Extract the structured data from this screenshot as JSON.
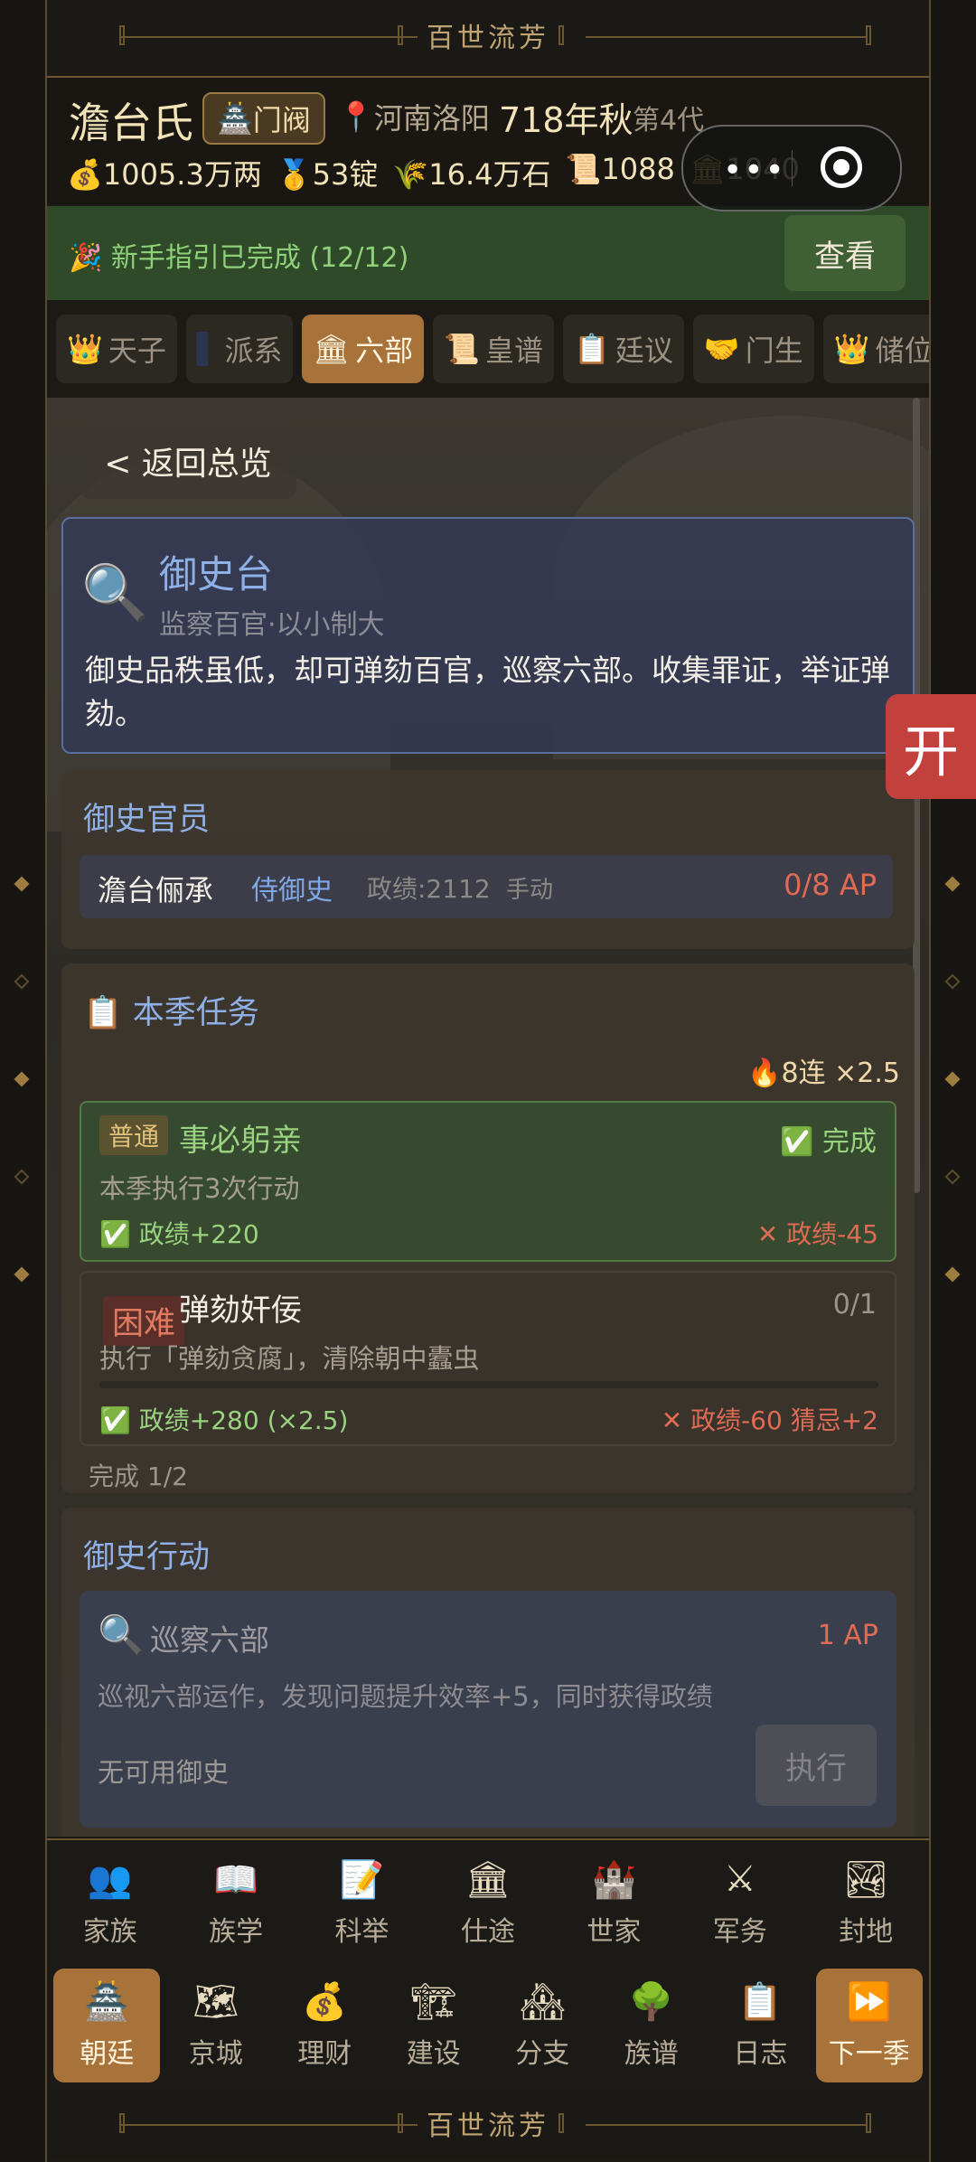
{
  "banner": {
    "title": "百世流芳"
  },
  "header": {
    "clan": "澹台氏",
    "badge": "门阀",
    "location": "河南洛阳",
    "year": "718年秋",
    "generation": "第4代",
    "resources": [
      {
        "icon": "💰",
        "value": "1005.3万两"
      },
      {
        "icon": "🥇",
        "value": "53锭"
      },
      {
        "icon": "🌾",
        "value": "16.4万石"
      },
      {
        "icon": "📜",
        "value": "1088"
      },
      {
        "icon": "🏛",
        "value": "1040"
      }
    ]
  },
  "capsule": {
    "more": "•••"
  },
  "guide": {
    "text": "🎉 新手指引已完成 (12/12)",
    "button": "查看"
  },
  "tabs": [
    {
      "icon": "👑",
      "label": "天子"
    },
    {
      "icon": "▌",
      "label": "派系"
    },
    {
      "icon": "🏛",
      "label": "六部",
      "active": true
    },
    {
      "icon": "📜",
      "label": "皇谱"
    },
    {
      "icon": "📋",
      "label": "廷议"
    },
    {
      "icon": "🤝",
      "label": "门生"
    },
    {
      "icon": "👑",
      "label": "储位"
    }
  ],
  "back": "< 返回总览",
  "office": {
    "icon": "🔍",
    "title": "御史台",
    "subtitle": "监察百官·以小制大",
    "description": "御史品秩虽低，却可弹劾百官，巡察六部。收集罪证，举证弹劾。"
  },
  "officers": {
    "heading": "御史官员",
    "row": {
      "name": "澹台俪承",
      "rank": "侍御史",
      "merit": "政绩:2112",
      "mode": "手动",
      "ap": "0/8 AP"
    }
  },
  "tasks": {
    "heading": "📋 本季任务",
    "streak": "🔥8连 ×2.5",
    "items": [
      {
        "tag": "普通",
        "name": "事必躬亲",
        "status": "✅ 完成",
        "desc": "本季执行3次行动",
        "reward": "✅ 政绩+220",
        "penalty": "✕ 政绩-45"
      },
      {
        "tag": "困难",
        "name": "弹劾奸佞",
        "status": "0/1",
        "desc": "执行「弹劾贪腐」，清除朝中蠹虫",
        "reward": "✅ 政绩+280 (×2.5)",
        "penalty": "✕ 政绩-60 猜忌+2",
        "progress": 0.0
      }
    ],
    "summary": "完成 1/2"
  },
  "actions": {
    "heading": "御史行动",
    "item": {
      "icon": "🔍",
      "name": "巡察六部",
      "ap": "1 AP",
      "desc": "巡视六部运作，发现问题提升效率+5，同时获得政绩",
      "note": "无可用御史",
      "button": "执行"
    }
  },
  "float_button": "开",
  "nav_top": [
    {
      "icon": "👥",
      "label": "家族"
    },
    {
      "icon": "📖",
      "label": "族学"
    },
    {
      "icon": "📝",
      "label": "科举"
    },
    {
      "icon": "🏛",
      "label": "仕途"
    },
    {
      "icon": "🏰",
      "label": "世家"
    },
    {
      "icon": "⚔",
      "label": "军务"
    },
    {
      "icon": "🏞",
      "label": "封地"
    }
  ],
  "nav_bottom": [
    {
      "icon": "🏯",
      "label": "朝廷",
      "active": true
    },
    {
      "icon": "🗺",
      "label": "京城"
    },
    {
      "icon": "💰",
      "label": "理财"
    },
    {
      "icon": "🏗",
      "label": "建设"
    },
    {
      "icon": "🏘",
      "label": "分支"
    },
    {
      "icon": "🌳",
      "label": "族谱"
    },
    {
      "icon": "📋",
      "label": "日志"
    },
    {
      "icon": "⏩",
      "label": "下一季",
      "active": true
    }
  ]
}
